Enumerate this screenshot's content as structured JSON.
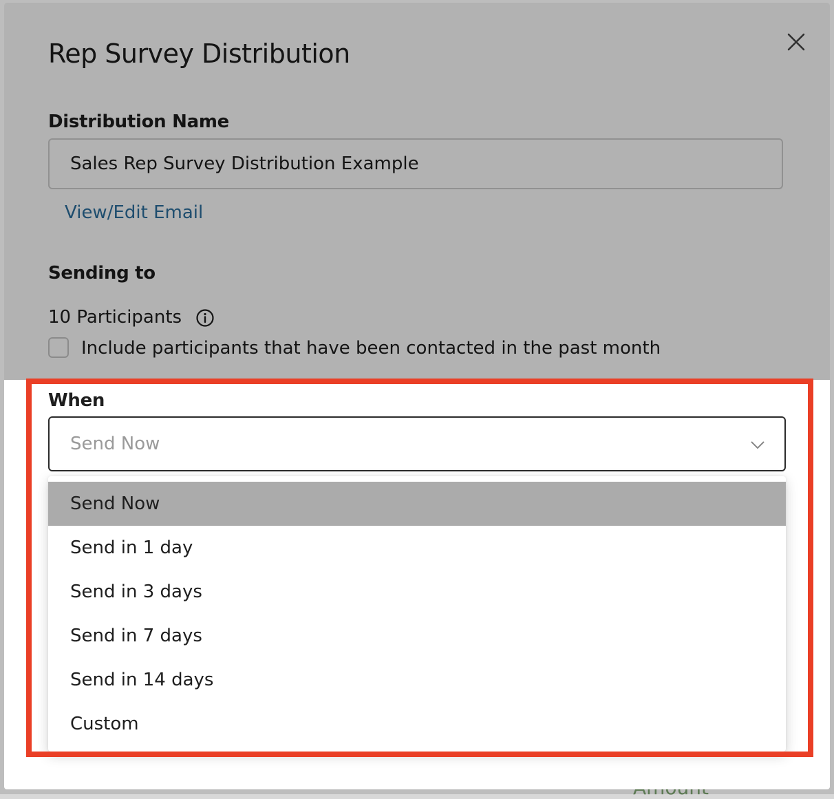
{
  "modal": {
    "title": "Rep Survey Distribution",
    "close_label": "X"
  },
  "distribution_name": {
    "label": "Distribution Name",
    "value": "Sales Rep Survey Distribution Example",
    "view_edit_email_link": "View/Edit Email"
  },
  "sending_to": {
    "label": "Sending to",
    "participants_text": "10 Participants",
    "include_contacted_label": "Include participants that have been contacted in the past month",
    "include_contacted_checked": false
  },
  "when": {
    "label": "When",
    "selected_value": "Send Now",
    "options": [
      {
        "label": "Send Now",
        "selected": true
      },
      {
        "label": "Send in 1 day",
        "selected": false
      },
      {
        "label": "Send in 3 days",
        "selected": false
      },
      {
        "label": "Send in 7 days",
        "selected": false
      },
      {
        "label": "Send in 14 days",
        "selected": false
      },
      {
        "label": "Custom",
        "selected": false
      }
    ]
  },
  "background": {
    "partial_text": "Amount"
  },
  "colors": {
    "highlight_frame": "#ea3f26",
    "link": "#2b6f9e",
    "selected_option_bg": "#ababab"
  },
  "icons": {
    "close": "close-icon",
    "info": "info-icon",
    "chevron": "chevron-down-icon"
  }
}
